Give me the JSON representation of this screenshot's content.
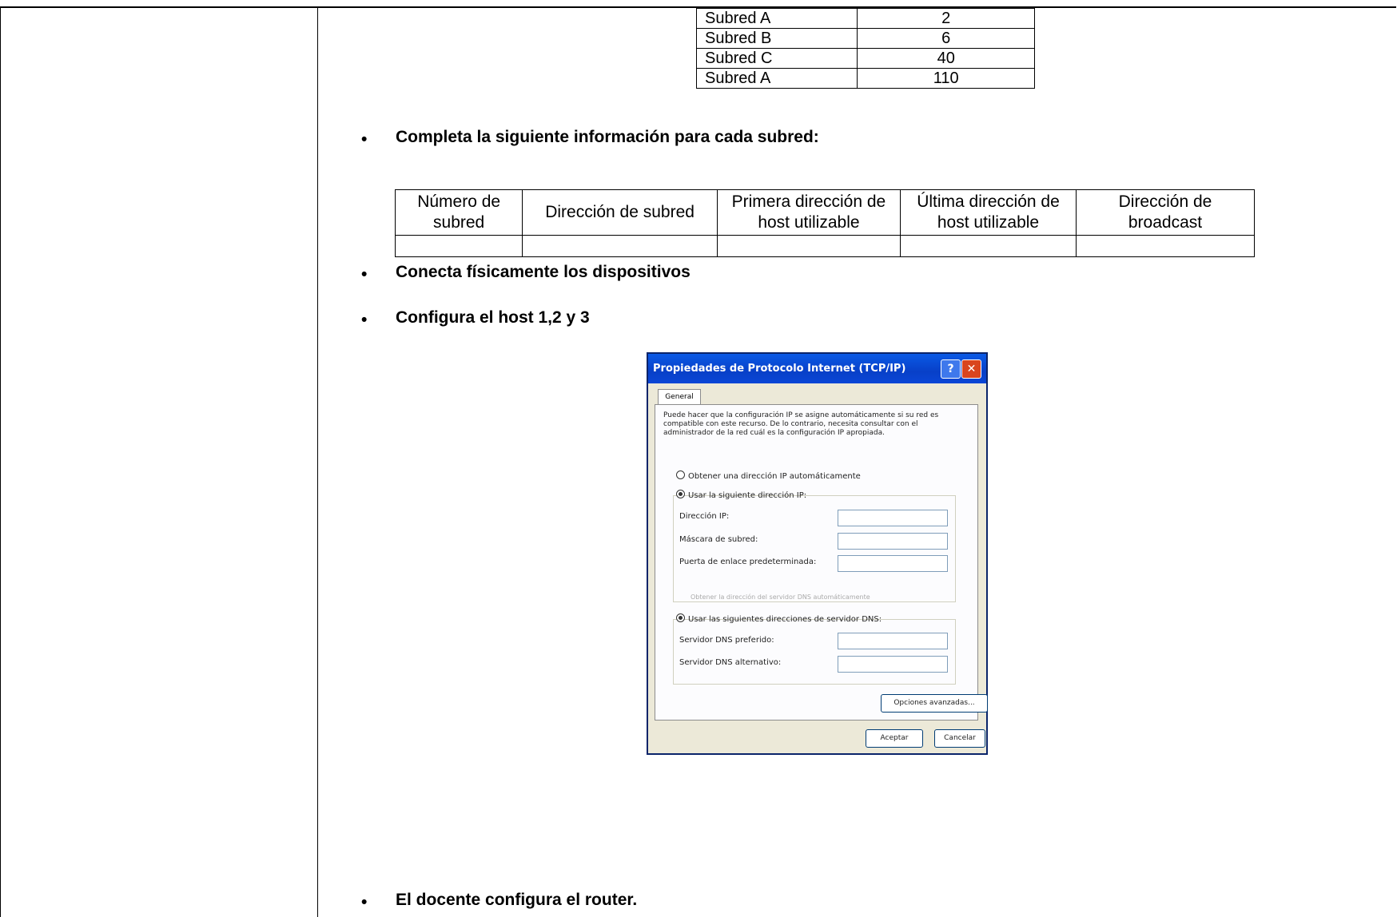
{
  "subnet_hosts": [
    {
      "name": "Subred A",
      "hosts": "2"
    },
    {
      "name": "Subred B",
      "hosts": "6"
    },
    {
      "name": "Subred C",
      "hosts": "40"
    },
    {
      "name": "Subred A",
      "hosts": "110"
    }
  ],
  "bullets": {
    "complete_info": "Completa la siguiente información para cada subred:",
    "connect": "Conecta físicamente los dispositivos",
    "configure_hosts": "Configura el host 1,2 y 3",
    "teacher_router": "El docente configura el router."
  },
  "info_table": {
    "headers": [
      "Número de subred",
      "Dirección de subred",
      "Primera dirección de host utilizable",
      "Última dirección de host utilizable",
      "Dirección de broadcast"
    ]
  },
  "dialog": {
    "title": "Propiedades de Protocolo Internet (TCP/IP)",
    "help_symbol": "?",
    "close_symbol": "✕",
    "tab_general": "General",
    "description": "Puede hacer que la configuración IP se asigne automáticamente si su red es compatible con este recurso. De lo contrario, necesita consultar con el administrador de la red cuál es la configuración IP apropiada.",
    "option_auto_ip": "Obtener una dirección IP automáticamente",
    "option_manual_ip": "Usar la siguiente dirección IP:",
    "label_ip": "Dirección IP:",
    "label_mask": "Máscara de subred:",
    "label_gateway": "Puerta de enlace predeterminada:",
    "option_auto_dns": "Obtener la dirección del servidor DNS automáticamente",
    "option_manual_dns": "Usar las siguientes direcciones de servidor DNS:",
    "label_dns_pref": "Servidor DNS preferido:",
    "label_dns_alt": "Servidor DNS alternativo:",
    "btn_advanced": "Opciones avanzadas...",
    "btn_accept": "Aceptar",
    "btn_cancel": "Cancelar"
  }
}
